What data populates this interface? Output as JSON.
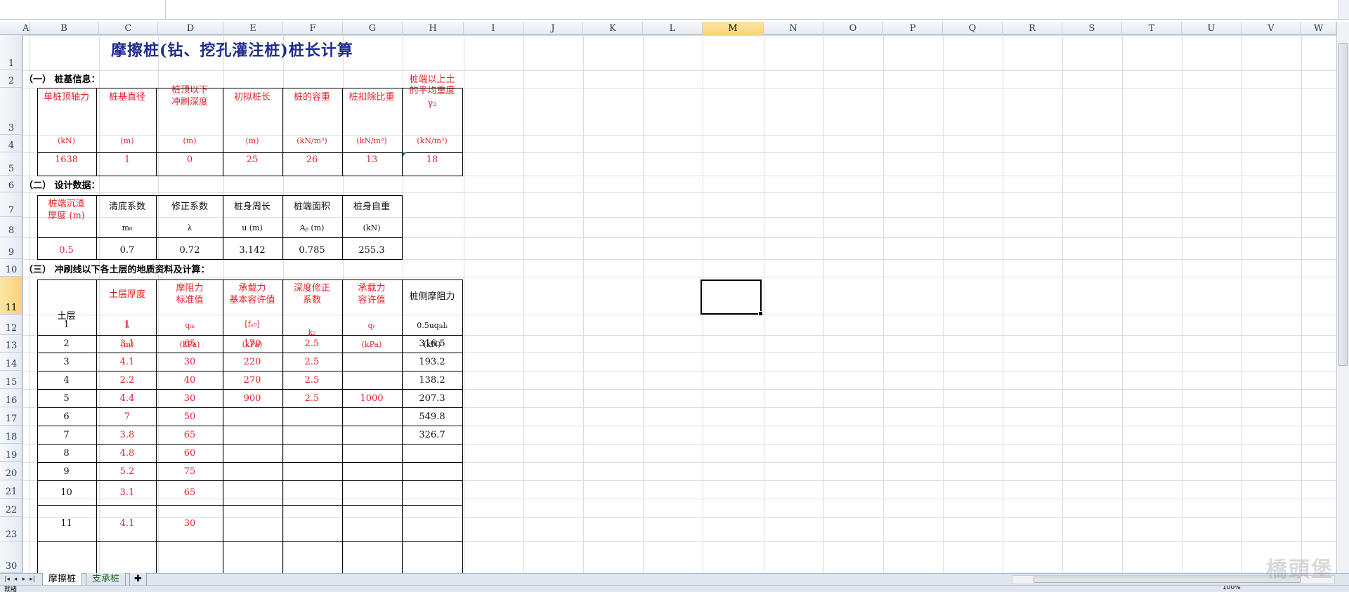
{
  "sheet": {
    "title": "摩擦桩(钻、挖孔灌注桩)桩长计算",
    "section1": "（一） 桩基信息：",
    "section2": "（二） 设计数据：",
    "section3": "（三） 冲刷线以下各土层的地质资料及计算：",
    "t1": {
      "h_axial": "单桩顶轴力",
      "u_axial": "(kN)",
      "v_axial": "1638",
      "h_dia": "桩基直径",
      "u_dia": "(m)",
      "v_dia": "1",
      "h_scour1": "桩顶以下",
      "h_scour2": "冲刷深度",
      "u_scour": "(m)",
      "v_scour": "0",
      "h_len": "初拟桩长",
      "u_len": "(m)",
      "v_len": "25",
      "h_unitw": "桩的容重",
      "u_unitw": "(kN/m³)",
      "v_unitw": "26",
      "h_buoy": "桩扣除比重",
      "u_buoy": "(kN/m³)",
      "v_buoy": "13",
      "h_soil1": "桩端以上土",
      "h_soil2": "的平均重度",
      "h_soil3": "γ₂",
      "u_soil": "(kN/m³)",
      "v_soil": "18"
    },
    "t2": {
      "h_sed1": "桩端沉渣",
      "h_sed2": "厚度 (m)",
      "v_sed": "0.5",
      "h_clean": "清底系数",
      "s_clean": "m₀",
      "v_clean": "0.7",
      "h_corr": "修正系数",
      "s_corr": "λ",
      "v_corr": "0.72",
      "h_perim": "桩身周长",
      "s_perim": "u (m)",
      "v_perim": "3.142",
      "h_area": "桩端面积",
      "s_area": "Aₚ (m)",
      "v_area": "0.785",
      "h_self": "桩身自重",
      "s_self": "(kN)",
      "v_self": "255.3"
    },
    "t3": {
      "h_layer": "土层",
      "h_thick": "土层厚度",
      "s_thick": "lᵢ",
      "u_thick": "(m)",
      "h_fric1": "摩阻力",
      "h_fric2": "标准值",
      "s_fric": "qᵢₖ",
      "u_fric": "(kPa)",
      "h_bear1": "承载力",
      "h_bear2": "基本容许值",
      "s_bear": "[fₐ₀]",
      "u_bear": "(kPa)",
      "h_depth1": "深度修正",
      "h_depth2": "系数",
      "s_depth": "k₂",
      "h_allow1": "承载力",
      "h_allow2": "容许值",
      "s_allow": "qᵣ",
      "u_allow": "(kPa)",
      "h_side": "桩侧摩阻力",
      "s_side": "0.5uqᵢₖlᵢ",
      "u_side": "(kN)",
      "rows": [
        {
          "n": "1",
          "l": "1",
          "q": "",
          "f": "",
          "k": "",
          "qr": "",
          "r": ""
        },
        {
          "n": "2",
          "l": "3.1",
          "q": "65",
          "f": "170",
          "k": "2.5",
          "qr": "",
          "r": "316.5"
        },
        {
          "n": "3",
          "l": "4.1",
          "q": "30",
          "f": "220",
          "k": "2.5",
          "qr": "",
          "r": "193.2"
        },
        {
          "n": "4",
          "l": "2.2",
          "q": "40",
          "f": "270",
          "k": "2.5",
          "qr": "",
          "r": "138.2"
        },
        {
          "n": "5",
          "l": "4.4",
          "q": "30",
          "f": "900",
          "k": "2.5",
          "qr": "1000",
          "r": "207.3"
        },
        {
          "n": "6",
          "l": "7",
          "q": "50",
          "f": "",
          "k": "",
          "qr": "",
          "r": "549.8"
        },
        {
          "n": "7",
          "l": "3.8",
          "q": "65",
          "f": "",
          "k": "",
          "qr": "",
          "r": "326.7"
        },
        {
          "n": "8",
          "l": "4.8",
          "q": "60",
          "f": "",
          "k": "",
          "qr": "",
          "r": ""
        },
        {
          "n": "9",
          "l": "5.2",
          "q": "75",
          "f": "",
          "k": "",
          "qr": "",
          "r": ""
        },
        {
          "n": "10",
          "l": "3.1",
          "q": "65",
          "f": "",
          "k": "",
          "qr": "",
          "r": ""
        },
        {
          "n": "11",
          "l": "4.1",
          "q": "30",
          "f": "",
          "k": "",
          "qr": "",
          "r": ""
        }
      ]
    }
  },
  "columns": [
    "A",
    "B",
    "C",
    "D",
    "E",
    "F",
    "G",
    "H",
    "I",
    "J",
    "K",
    "L",
    "M",
    "N",
    "O",
    "P",
    "Q",
    "R",
    "S",
    "T",
    "U",
    "V",
    "W"
  ],
  "rows": [
    "1",
    "2",
    "3",
    "4",
    "5",
    "6",
    "7",
    "8",
    "9",
    "10",
    "11",
    "12",
    "13",
    "14",
    "15",
    "16",
    "17",
    "18",
    "19",
    "20",
    "21",
    "22",
    "23",
    "30"
  ],
  "selected_column": "M",
  "selected_row": "11",
  "tabs": {
    "sheet1": "摩擦桩",
    "sheet2": "支承桩"
  },
  "status": {
    "left": "就绪",
    "zoom": "100%"
  },
  "watermark": "橋頭堡",
  "colors": {
    "red": "#e8202a",
    "title": "#1f2c8f",
    "header_bg": "#e6eaf0",
    "select": "#f8d27a"
  }
}
